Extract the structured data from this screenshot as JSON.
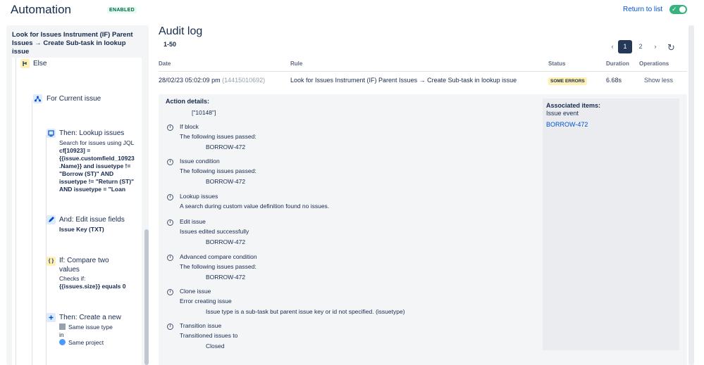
{
  "header": {
    "title": "Automation",
    "status": "ENABLED",
    "return_link": "Return to list",
    "toggle_state": "on",
    "toggle_check": "✓"
  },
  "sidebar": {
    "rule_name": "Look for Issues Instrument (IF) Parent Issues → Create Sub-task in lookup issue",
    "nodes": {
      "else": {
        "label": "Else",
        "icon": "branch-icon"
      },
      "for_current": {
        "label": "For Current issue",
        "icon": "hierarchy-icon"
      },
      "lookup": {
        "title": "Then: Lookup issues",
        "line1": "Search for issues using JQL",
        "jql1": "cf[10923] =",
        "jql2": "{{issue.customfield_10923",
        "jql3": ".Name}} and issuetype !=",
        "jql4": "\"Borrow (ST)\" AND",
        "jql5": "issuetype != \"Return (ST)\"",
        "jql6": "AND issuetype = \"Loan",
        "icon": "search-list-icon"
      },
      "edit": {
        "title": "And: Edit issue fields",
        "sub": "Issue Key (TXT)",
        "icon": "pencil-icon"
      },
      "compare": {
        "title": "If: Compare two",
        "title2": "values",
        "checks": "Checks if:",
        "expr": "{{issues.size}} equals 0",
        "icon": "braces-icon",
        "icon_glyph": "{ }"
      },
      "create": {
        "title": "Then: Create a new",
        "type": "Same issue type",
        "in": "in",
        "project": "Same project",
        "icon": "plus-icon"
      }
    }
  },
  "main": {
    "title": "Audit log",
    "range": "1-50",
    "pages": [
      "1",
      "2"
    ],
    "active_page": "1",
    "columns": {
      "date": "Date",
      "rule": "Rule",
      "status": "Status",
      "duration": "Duration",
      "operations": "Operations"
    },
    "row": {
      "date": "28/02/23 05:02:09 pm",
      "id": "(14415010692)",
      "rule": "Look for Issues Instrument (IF) Parent Issues → Create Sub-task in lookup issue",
      "status": "SOME ERRORS",
      "duration": "6.68s",
      "operation": "Show less"
    },
    "details": {
      "action_label": "Action details:",
      "action_value": "[\"10148\"]",
      "entries": [
        {
          "title": "If block",
          "desc": "The following issues passed:",
          "value": "BORROW-472"
        },
        {
          "title": "Issue condition",
          "desc": "The following issues passed:",
          "value": "BORROW-472"
        },
        {
          "title": "Lookup issues",
          "desc": "A search during custom value definition found no issues.",
          "value": ""
        },
        {
          "title": "Edit issue",
          "desc": "Issues edited successfully",
          "value": "BORROW-472"
        },
        {
          "title": "Advanced compare condition",
          "desc": "The following issues passed:",
          "value": "BORROW-472"
        },
        {
          "title": "Clone issue",
          "desc": "Error creating issue",
          "value": "Issue type is a sub-task but parent issue key or id not specified. (issuetype)"
        },
        {
          "title": "Transition issue",
          "desc": "Transitioned issues to",
          "value": "Closed"
        }
      ],
      "associated": {
        "label": "Associated items:",
        "sub": "Issue event",
        "link": "BORROW-472"
      }
    }
  },
  "colors": {
    "accent": "#0052cc",
    "toggle": "#36b37e",
    "warning_badge": "#fff0b3",
    "active_page": "#253858"
  }
}
